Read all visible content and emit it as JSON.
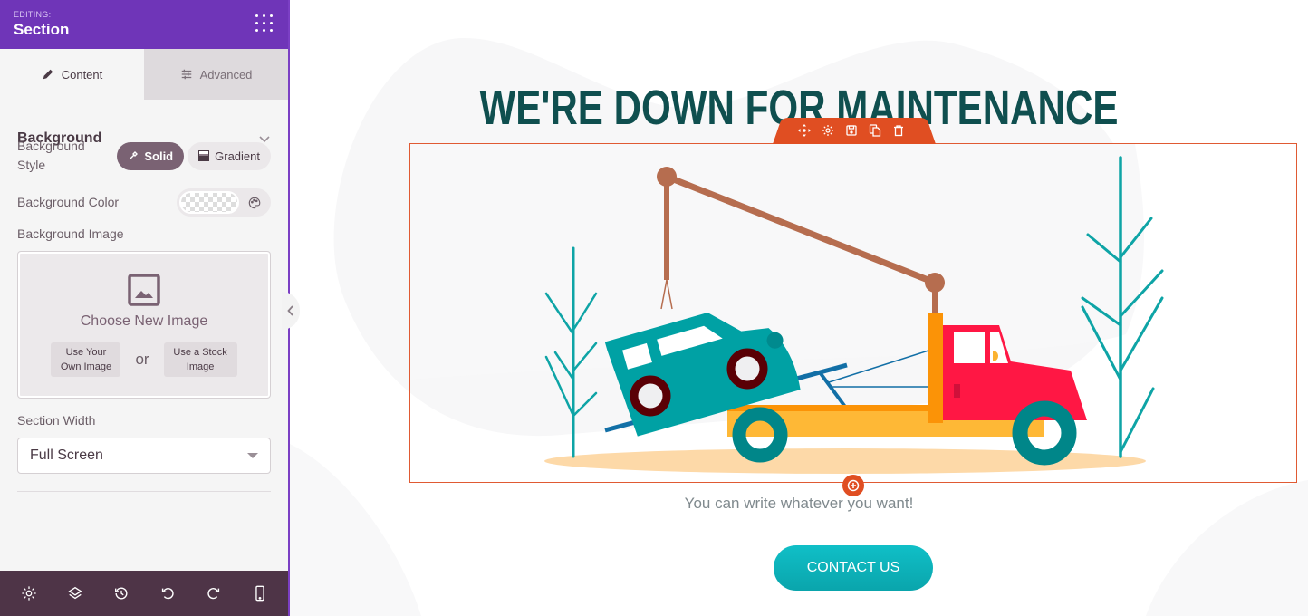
{
  "sidebar": {
    "header": {
      "editing_label": "EDITING:",
      "title": "Section"
    },
    "tabs": [
      {
        "label": "Content",
        "icon": "pencil-icon",
        "active": true
      },
      {
        "label": "Advanced",
        "icon": "sliders-icon",
        "active": false
      }
    ],
    "background_section": {
      "title": "Background",
      "style_label": "Background Style",
      "style_options": [
        {
          "label": "Solid",
          "icon": "eyedropper-icon",
          "selected": true
        },
        {
          "label": "Gradient",
          "icon": "gradient-icon",
          "selected": false
        }
      ],
      "color_label": "Background Color",
      "color_value": "transparent",
      "image_label": "Background Image",
      "choose_image": "Choose New Image",
      "own_image_button": "Use Your Own Image",
      "or_text": "or",
      "stock_image_button": "Use a Stock Image",
      "width_label": "Section Width",
      "width_value": "Full Screen"
    },
    "footer_icons": [
      "settings-icon",
      "layers-icon",
      "history-icon",
      "undo-icon",
      "redo-icon",
      "mobile-icon"
    ]
  },
  "canvas": {
    "heading": "WE'RE DOWN FOR MAINTENANCE",
    "section_toolbar_icons": [
      "move-icon",
      "settings-icon",
      "save-icon",
      "copy-icon",
      "delete-icon"
    ],
    "subtitle": "You can write whatever you want!",
    "cta_label": "CONTACT US"
  },
  "colors": {
    "header_purple": "#6f35b8",
    "sidebar_footer": "#4e3447",
    "accent_mauve": "#7a6273",
    "section_outline": "#e05a33",
    "heading_teal": "#0f4f4f",
    "cta_teal": "#10bfc7"
  }
}
